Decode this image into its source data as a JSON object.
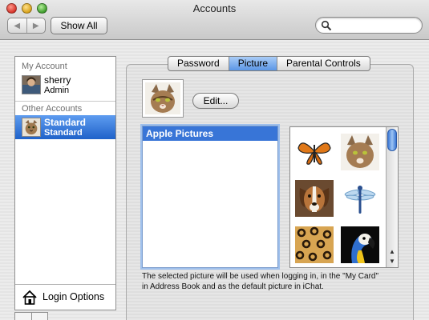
{
  "window": {
    "title": "Accounts",
    "show_all_label": "Show All",
    "back_glyph": "◀",
    "forward_glyph": "▶"
  },
  "search": {
    "value": "",
    "placeholder": ""
  },
  "sidebar": {
    "my_account_header": "My Account",
    "my_account": {
      "name": "sherry",
      "type": "Admin"
    },
    "other_accounts_header": "Other Accounts",
    "other_accounts": [
      {
        "name": "Standard",
        "type": "Standard",
        "selected": true
      }
    ],
    "login_options_label": "Login Options"
  },
  "tabs": [
    {
      "label": "Password",
      "active": false
    },
    {
      "label": "Picture",
      "active": true
    },
    {
      "label": "Parental Controls",
      "active": false
    }
  ],
  "picture": {
    "edit_label": "Edit...",
    "list_items": [
      {
        "label": "Apple Pictures",
        "selected": true
      }
    ],
    "thumbnails": [
      "butterfly",
      "cat",
      "dog",
      "dragonfly",
      "leopard-fur",
      "parrot"
    ],
    "caption": "The selected picture will be used when logging in, in the \"My Card\" in Address Book and as the default picture in iChat."
  },
  "colors": {
    "selection": "#3875d7",
    "tab_active": "#6aa0ea"
  }
}
